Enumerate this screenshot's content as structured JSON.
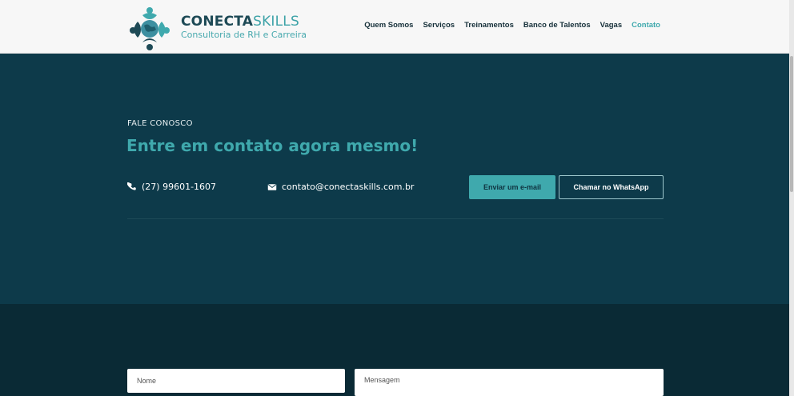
{
  "header": {
    "logo": {
      "name_bold": "CONECTA",
      "name_light": "SKILLS",
      "tagline": "Consultoria de RH e Carreira"
    },
    "nav": [
      {
        "label": "Quem Somos",
        "active": false
      },
      {
        "label": "Serviços",
        "active": false
      },
      {
        "label": "Treinamentos",
        "active": false
      },
      {
        "label": "Banco de Talentos",
        "active": false
      },
      {
        "label": "Vagas",
        "active": false
      },
      {
        "label": "Contato",
        "active": true
      }
    ]
  },
  "hero": {
    "eyebrow": "FALE CONOSCO",
    "headline": "Entre em contato agora mesmo!",
    "phone": {
      "icon": "phone-icon",
      "text": "(27) 99601-1607"
    },
    "email": {
      "icon": "envelope-icon",
      "text": "contato@conectaskills.com.br"
    },
    "buttons": {
      "email": "Enviar um e-mail",
      "whatsapp": "Chamar no WhatsApp"
    }
  },
  "form": {
    "nome_placeholder": "Nome",
    "mensagem_placeholder": "Mensagem"
  },
  "colors": {
    "accent": "#3fa9ad",
    "hero_bg": "#0d3a4a",
    "form_bg": "#0a2a35",
    "header_bg": "#f7f7f7"
  }
}
